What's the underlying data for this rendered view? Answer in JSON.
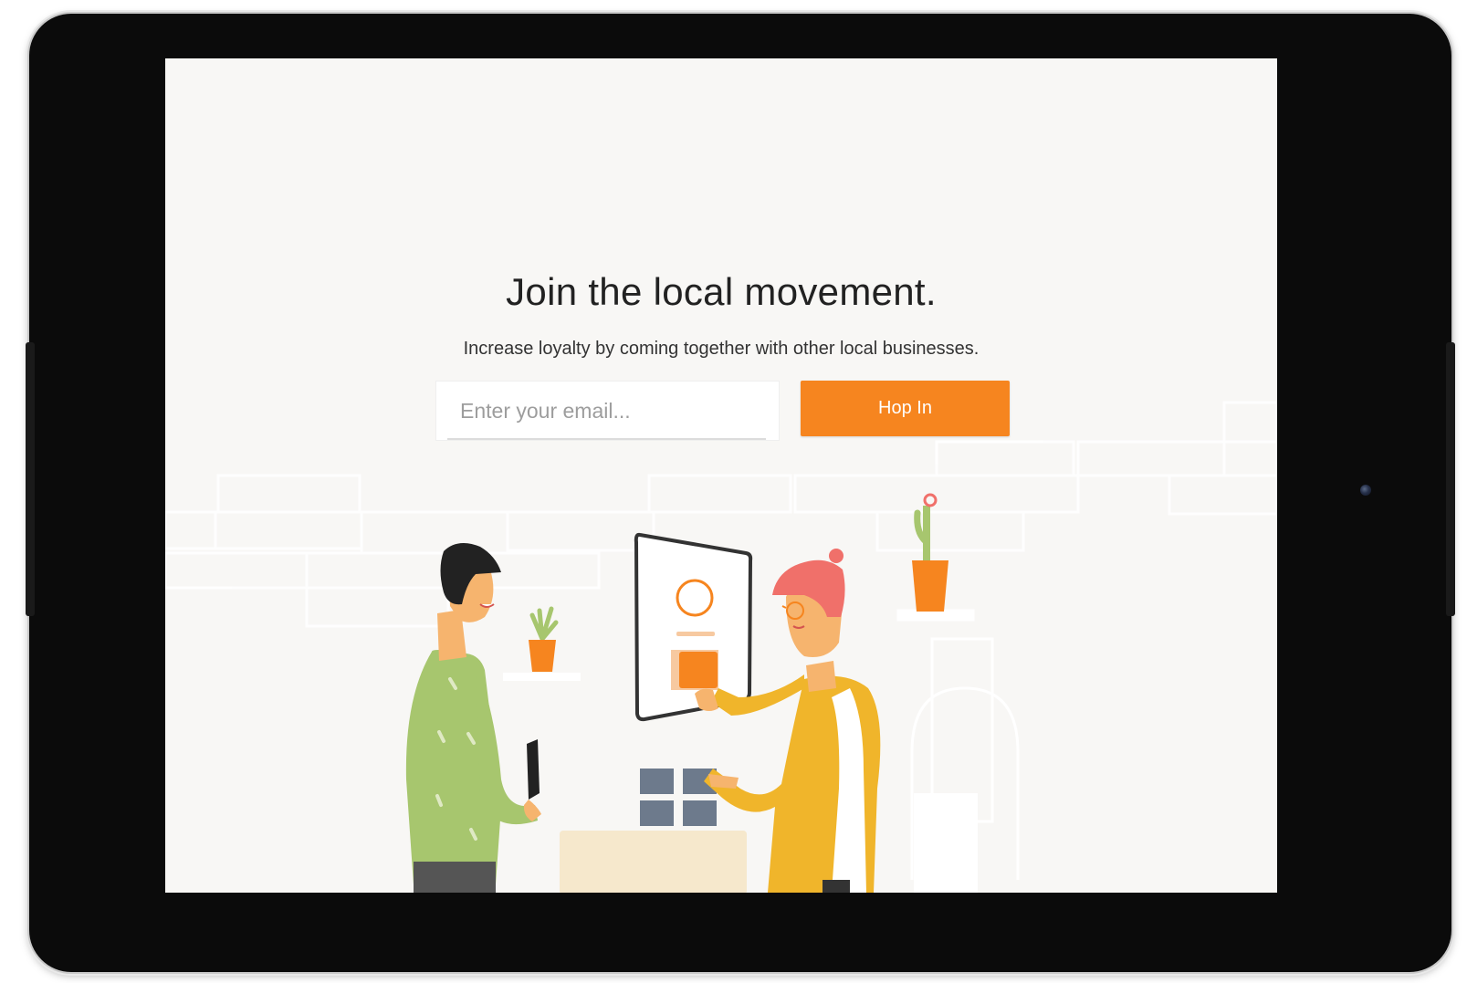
{
  "hero": {
    "headline": "Join the local movement.",
    "subheadline": "Increase loyalty by coming together with other local businesses."
  },
  "signup": {
    "email_placeholder": "Enter your email...",
    "email_value": "",
    "submit_label": "Hop In"
  },
  "colors": {
    "accent": "#f6851f",
    "screen_background": "#f8f7f5",
    "device_bezel": "#0b0b0b",
    "shirt_green": "#a7c66e",
    "sweater_yellow": "#f0b52b",
    "hair_red": "#f0706a"
  },
  "illustration": {
    "icons": [
      "brick-wall-pattern",
      "customer-figure",
      "merchant-figure",
      "tablet-kiosk",
      "potted-plant",
      "potted-cactus",
      "phone",
      "counter"
    ]
  }
}
